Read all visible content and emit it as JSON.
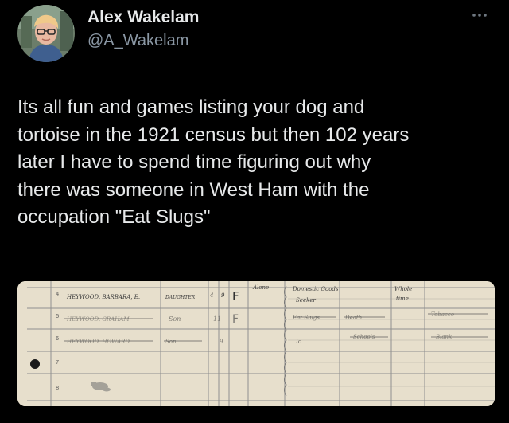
{
  "user": {
    "display_name": "Alex Wakelam",
    "handle": "@A_Wakelam"
  },
  "tweet": {
    "text": "Its all fun and games listing your dog and\ntortoise in the 1921 census but then 102 years\nlater I have to spend time figuring out why\nthere was someone in West Ham with the\noccupation \"Eat Slugs\""
  },
  "media": {
    "row_numbers": [
      "4",
      "5",
      "6",
      "7",
      "8"
    ],
    "row4": {
      "name": "HEYWOOD, BARBARA, E.",
      "relationship": "DAUGHTER",
      "age": "4",
      "months": "9",
      "sex": "F",
      "marital": "Alone",
      "occupation_top": "Domestic Goods",
      "occupation_bottom": "Seeker",
      "time_top": "Whole",
      "time_bottom": "time"
    },
    "row5": {
      "name": "HEYWOOD, GRAHAM",
      "relationship": "Son",
      "age": "11",
      "sex": "F",
      "occupation": "Eat Slugs",
      "employer": "Death",
      "extra": "Tobacco"
    },
    "row6": {
      "name": "HEYWOOD, HOWARD",
      "relationship": "Son",
      "age": "9",
      "occupation": "Ic",
      "employer": "Schools",
      "extra": "Blank"
    }
  },
  "colors": {
    "background": "#000000",
    "text_primary": "#e7e9ea",
    "text_secondary": "#8b98a5",
    "paper": "#ece5d3"
  }
}
